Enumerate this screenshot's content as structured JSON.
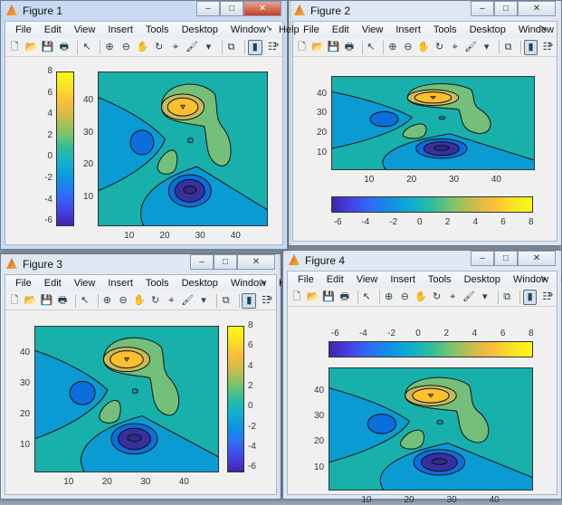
{
  "menu": [
    "File",
    "Edit",
    "View",
    "Insert",
    "Tools",
    "Desktop",
    "Window",
    "Help"
  ],
  "toolbar_icons": [
    {
      "name": "new-figure-icon",
      "glyph": "🗋"
    },
    {
      "name": "open-file-icon",
      "glyph": "📂"
    },
    {
      "name": "save-icon",
      "glyph": "💾"
    },
    {
      "name": "print-icon",
      "glyph": "🖶"
    },
    {
      "sep": true
    },
    {
      "name": "edit-plot-pointer-icon",
      "glyph": "↖"
    },
    {
      "sep": true
    },
    {
      "name": "zoom-in-icon",
      "glyph": "⊕"
    },
    {
      "name": "zoom-out-icon",
      "glyph": "⊖"
    },
    {
      "name": "pan-hand-icon",
      "glyph": "✋"
    },
    {
      "name": "rotate-3d-icon",
      "glyph": "↻"
    },
    {
      "name": "data-cursor-icon",
      "glyph": "⌖"
    },
    {
      "name": "brush-icon",
      "glyph": "🖌"
    },
    {
      "name": "brush-dropdown-icon",
      "glyph": "▾"
    },
    {
      "sep": true
    },
    {
      "name": "link-plot-icon",
      "glyph": "⧉"
    },
    {
      "sep": true
    },
    {
      "name": "insert-colorbar-icon",
      "glyph": "▮",
      "toggled": true
    },
    {
      "name": "insert-legend-icon",
      "glyph": "☷"
    }
  ],
  "window_buttons": {
    "minimize": "–",
    "maximize": "□",
    "close": "✕"
  },
  "axis_ticks": {
    "x": [
      "10",
      "20",
      "30",
      "40"
    ],
    "y": [
      "10",
      "20",
      "30",
      "40"
    ],
    "xlim": [
      1,
      49
    ],
    "ylim": [
      1,
      49
    ]
  },
  "colorbar": {
    "ticks": [
      "-6",
      "-4",
      "-2",
      "0",
      "2",
      "4",
      "6",
      "8"
    ],
    "range": [
      -6.5,
      8
    ]
  },
  "windows": [
    {
      "title": "Figure 2",
      "colorbar_location": "southoutside"
    },
    {
      "title": "Figure 3",
      "colorbar_location": "eastoutside"
    },
    {
      "title": "Figure 4",
      "colorbar_location": "northoutside"
    },
    {
      "title": "Figure 1",
      "colorbar_location": "westoutside",
      "active": true
    }
  ],
  "colors": {
    "teal": "#17b0aa",
    "blue2": "#0b9bd3",
    "blue4": "#0a6fdc",
    "blue6": "#3a2f9f",
    "blue7": "#2e2a86",
    "green": "#74bf79",
    "tan": "#c9ba5c",
    "orange": "#fcc02e"
  }
}
